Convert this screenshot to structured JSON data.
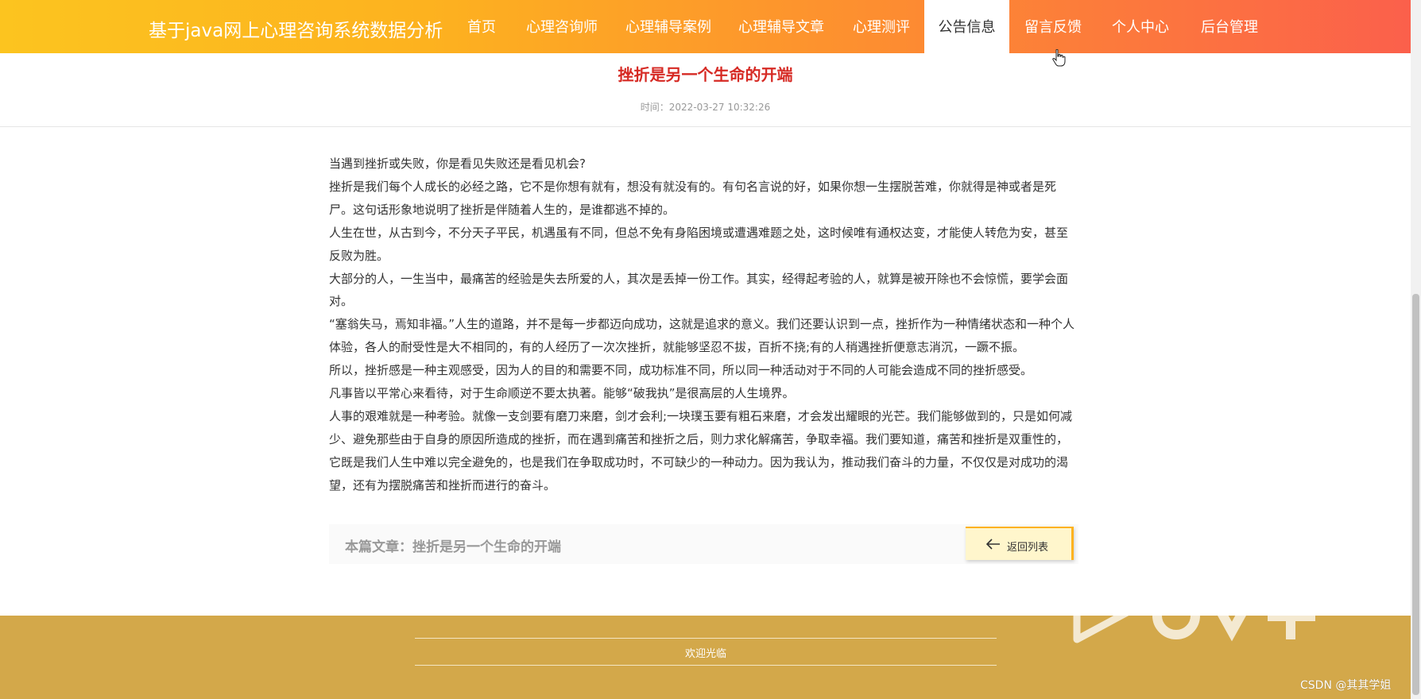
{
  "header": {
    "site_title": "基于java网上心理咨询系统数据分析",
    "nav": [
      {
        "label": "首页",
        "active": false
      },
      {
        "label": "心理咨询师",
        "active": false
      },
      {
        "label": "心理辅导案例",
        "active": false
      },
      {
        "label": "心理辅导文章",
        "active": false
      },
      {
        "label": "心理测评",
        "active": false
      },
      {
        "label": "公告信息",
        "active": true
      },
      {
        "label": "留言反馈",
        "active": false
      },
      {
        "label": "个人中心",
        "active": false
      },
      {
        "label": "后台管理",
        "active": false
      }
    ]
  },
  "article": {
    "title": "挫折是另一个生命的开端",
    "time_label": "时间：",
    "time_value": "2022-03-27 10:32:26",
    "paragraphs": [
      "当遇到挫折或失败，你是看见失败还是看见机会?",
      "挫折是我们每个人成长的必经之路，它不是你想有就有，想没有就没有的。有句名言说的好，如果你想一生摆脱苦难，你就得是神或者是死尸。这句话形象地说明了挫折是伴随着人生的，是谁都逃不掉的。",
      "人生在世，从古到今，不分天子平民，机遇虽有不同，但总不免有身陷困境或遭遇难题之处，这时候唯有通权达变，才能使人转危为安，甚至反败为胜。",
      "大部分的人，一生当中，最痛苦的经验是失去所爱的人，其次是丢掉一份工作。其实，经得起考验的人，就算是被开除也不会惊慌，要学会面对。",
      "“塞翁失马，焉知非福。”人生的道路，并不是每一步都迈向成功，这就是追求的意义。我们还要认识到一点，挫折作为一种情绪状态和一种个人体验，各人的耐受性是大不相同的，有的人经历了一次次挫折，就能够坚忍不拔，百折不挠;有的人稍遇挫折便意志消沉，一蹶不振。",
      "所以，挫折感是一种主观感受，因为人的目的和需要不同，成功标准不同，所以同一种活动对于不同的人可能会造成不同的挫折感受。",
      "凡事皆以平常心来看待，对于生命顺逆不要太执著。能够“破我执”是很高层的人生境界。",
      "人事的艰难就是一种考验。就像一支剑要有磨刀来磨，剑才会利;一块璞玉要有粗石来磨，才会发出耀眼的光芒。我们能够做到的，只是如何减少、避免那些由于自身的原因所造成的挫折，而在遇到痛苦和挫折之后，则力求化解痛苦，争取幸福。我们要知道，痛苦和挫折是双重性的，它既是我们人生中难以完全避免的，也是我们在争取成功时，不可缺少的一种动力。因为我认为，推动我们奋斗的力量，不仅仅是对成功的渴望，还有为摆脱痛苦和挫折而进行的奋斗。"
    ],
    "current_label": "本篇文章：挫折是另一个生命的开端",
    "back_button": "返回列表"
  },
  "footer": {
    "welcome": "欢迎光临"
  },
  "watermark": {
    "csdn": "CSDN @其其学姐"
  },
  "colors": {
    "header_gradient_start": "#fcc41f",
    "header_gradient_end": "#fb5f4c",
    "title_red": "#d62a24",
    "footer_gold": "#d3a84a"
  },
  "icons": {
    "back": "arrow-left-icon",
    "cursor": "hand-pointer-icon"
  }
}
